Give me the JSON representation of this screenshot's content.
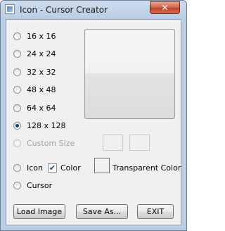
{
  "window": {
    "title": "Icon - Cursor Creator",
    "close_label": "✕"
  },
  "sizes": [
    {
      "label": "16 x 16",
      "checked": false
    },
    {
      "label": "24 x 24",
      "checked": false
    },
    {
      "label": "32 x 32",
      "checked": false
    },
    {
      "label": "48 x 48",
      "checked": false
    },
    {
      "label": "64 x 64",
      "checked": false
    },
    {
      "label": "128 x 128",
      "checked": true
    },
    {
      "label": "Custom Size",
      "checked": false,
      "disabled": true
    }
  ],
  "output_type": {
    "icon_label": "Icon",
    "cursor_label": "Cursor",
    "selected": "none"
  },
  "color": {
    "checkbox_label": "Color",
    "checked": true,
    "check_mark": "✔",
    "transparent_label": "Transparent Color"
  },
  "buttons": {
    "load": "Load Image",
    "save": "Save As...",
    "exit": "EXIT"
  }
}
